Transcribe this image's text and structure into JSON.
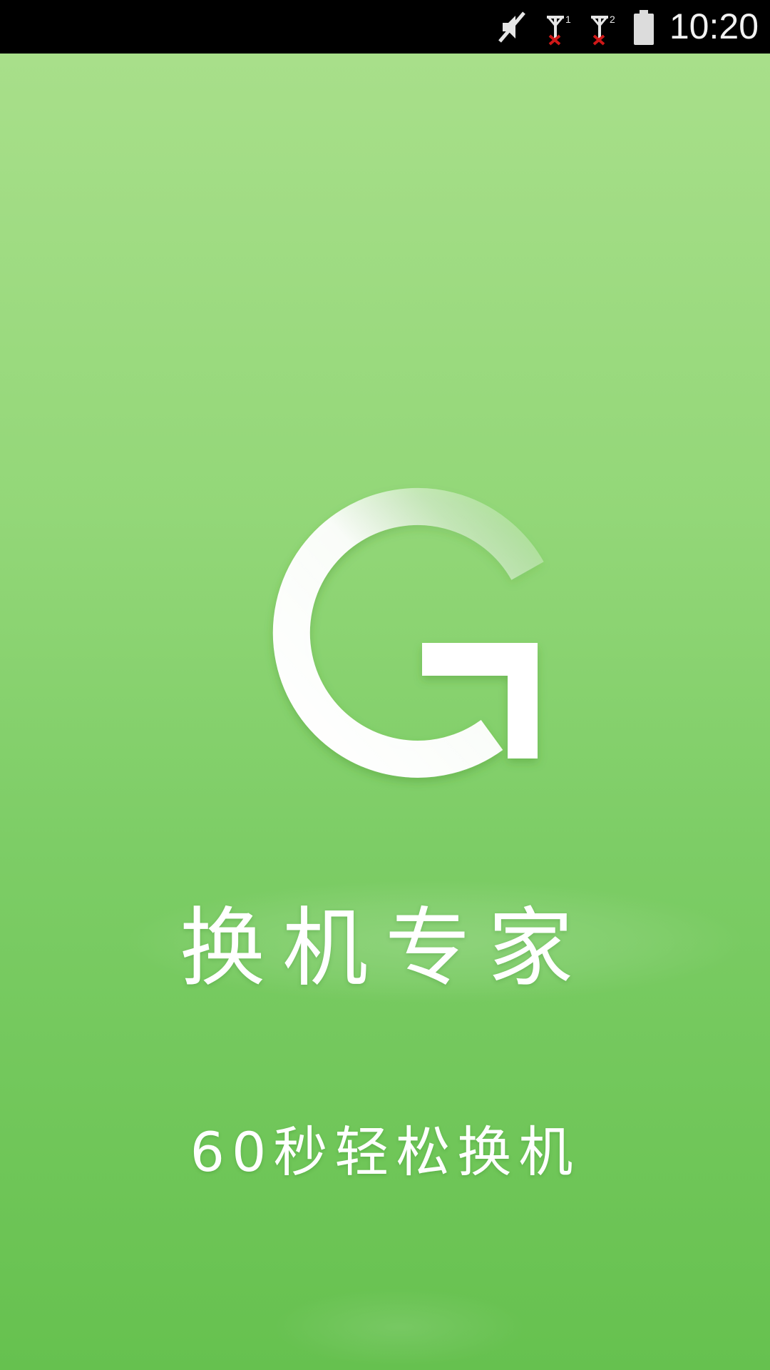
{
  "status_bar": {
    "time": "10:20",
    "icons": [
      "mute-icon",
      "sim1-no-signal-icon",
      "sim2-no-signal-icon",
      "battery-icon"
    ],
    "sim1_label": "1",
    "sim2_label": "2"
  },
  "splash": {
    "logo_icon": "refresh-arrow-logo-icon",
    "title": "换机专家",
    "slogan": "60秒轻松换机"
  },
  "colors": {
    "background_top": "#a8df8a",
    "background_bottom": "#66c14f",
    "foreground": "#ffffff",
    "status_bar": "#000000"
  }
}
